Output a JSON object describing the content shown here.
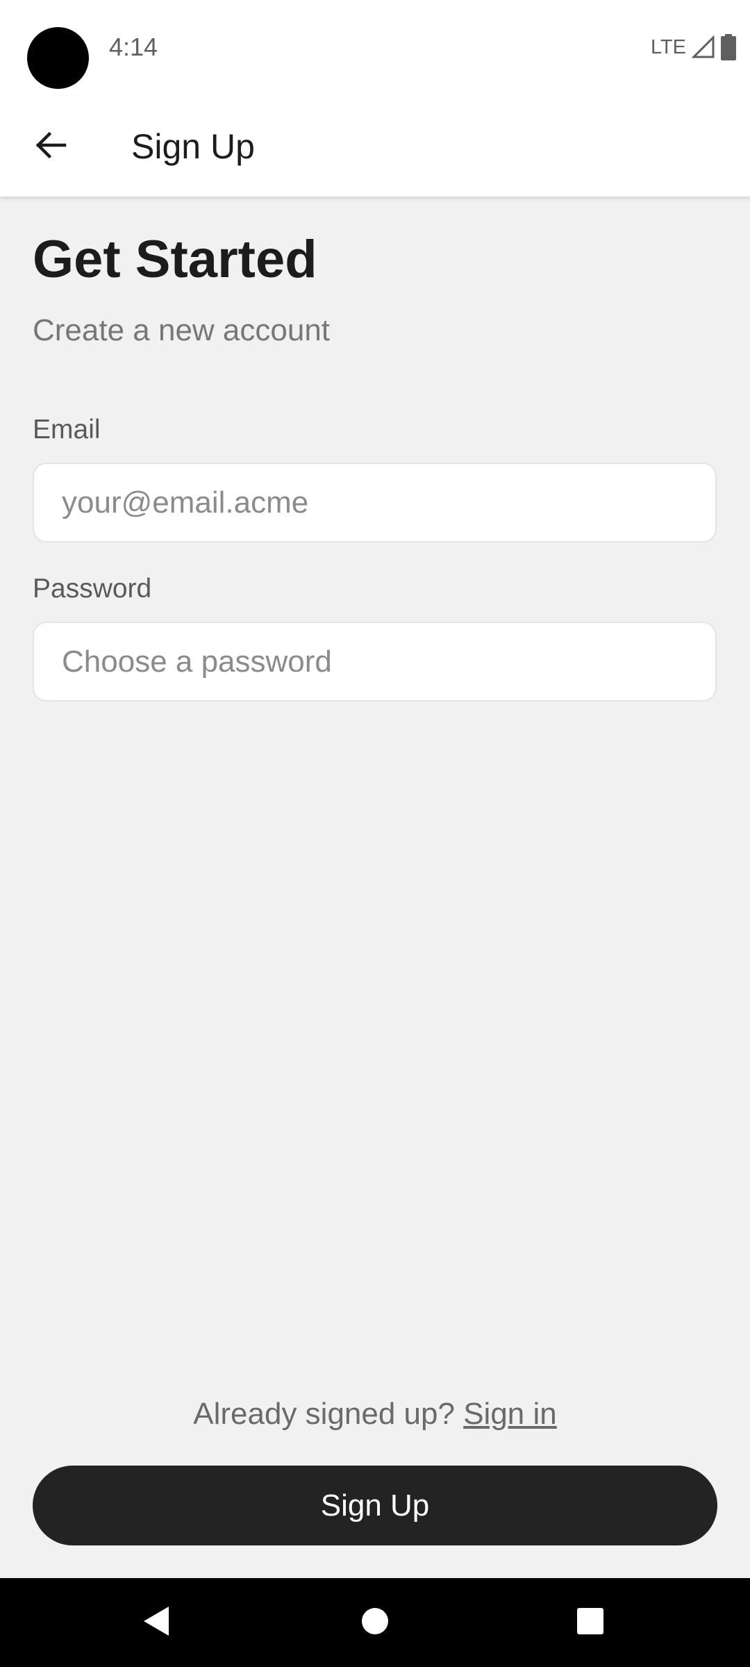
{
  "status_bar": {
    "time": "4:14",
    "network": "LTE",
    "icons": [
      "camera-cutout",
      "signal-icon",
      "battery-icon"
    ]
  },
  "app_bar": {
    "back_icon": "arrow-left-icon",
    "title": "Sign Up"
  },
  "main": {
    "heading": "Get Started",
    "subheading": "Create a new account",
    "email": {
      "label": "Email",
      "value": "",
      "placeholder": "your@email.acme"
    },
    "password": {
      "label": "Password",
      "value": "",
      "placeholder": "Choose a password"
    },
    "signin_prompt": "Already signed up?",
    "signin_link": "Sign in",
    "submit_label": "Sign Up"
  },
  "nav_bar": {
    "icons": [
      "nav-back-icon",
      "nav-home-icon",
      "nav-recents-icon"
    ]
  },
  "colors": {
    "background": "#f1f1f1",
    "surface": "#ffffff",
    "primary_button": "#232323",
    "text_primary": "#1c1c1c",
    "text_secondary": "#777777"
  }
}
